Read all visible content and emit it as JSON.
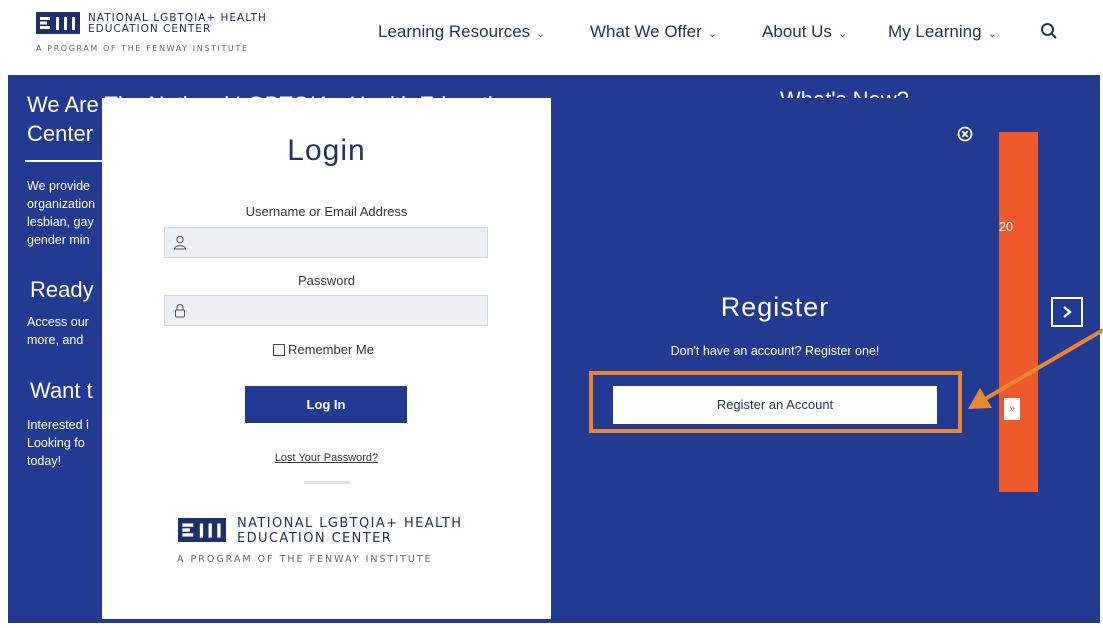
{
  "header": {
    "logo_line1": "NATIONAL LGBTQIA+ HEALTH",
    "logo_line2": "EDUCATION CENTER",
    "logo_line3": "A PROGRAM OF THE FENWAY INSTITUTE",
    "nav": [
      {
        "label": "Learning Resources"
      },
      {
        "label": "What We Offer"
      },
      {
        "label": "About Us"
      },
      {
        "label": "My Learning"
      }
    ]
  },
  "background": {
    "heading1_line1": "We Are The National LGBTQIA+ Health Education",
    "heading1_line2": "Center",
    "para1": [
      "We provide",
      "organization",
      "lesbian, gay",
      "gender min"
    ],
    "heading2": "Ready",
    "para2": [
      "Access our",
      "more, and "
    ],
    "heading3": "Want t",
    "para3": [
      "Interested i",
      "Looking fo",
      "today!"
    ],
    "right_heading": "What's New?",
    "orange_fragment": "20",
    "small_arrow": "»"
  },
  "login": {
    "title": "Login",
    "username_label": "Username or Email Address",
    "username_value": "",
    "password_label": "Password",
    "password_value": "",
    "remember_label": "Remember Me",
    "login_button": "Log In",
    "lost_password": "Lost Your Password?",
    "footer_logo_line1": "NATIONAL LGBTQIA+ HEALTH",
    "footer_logo_line2": "EDUCATION CENTER",
    "footer_logo_line3": "A PROGRAM OF THE FENWAY INSTITUTE"
  },
  "register": {
    "title": "Register",
    "subtitle": "Don't have an account? Register one!",
    "button": "Register an Account"
  },
  "colors": {
    "brand_blue": "#233a93",
    "orange_panel": "#ef5a2a",
    "highlight": "#e98631"
  }
}
